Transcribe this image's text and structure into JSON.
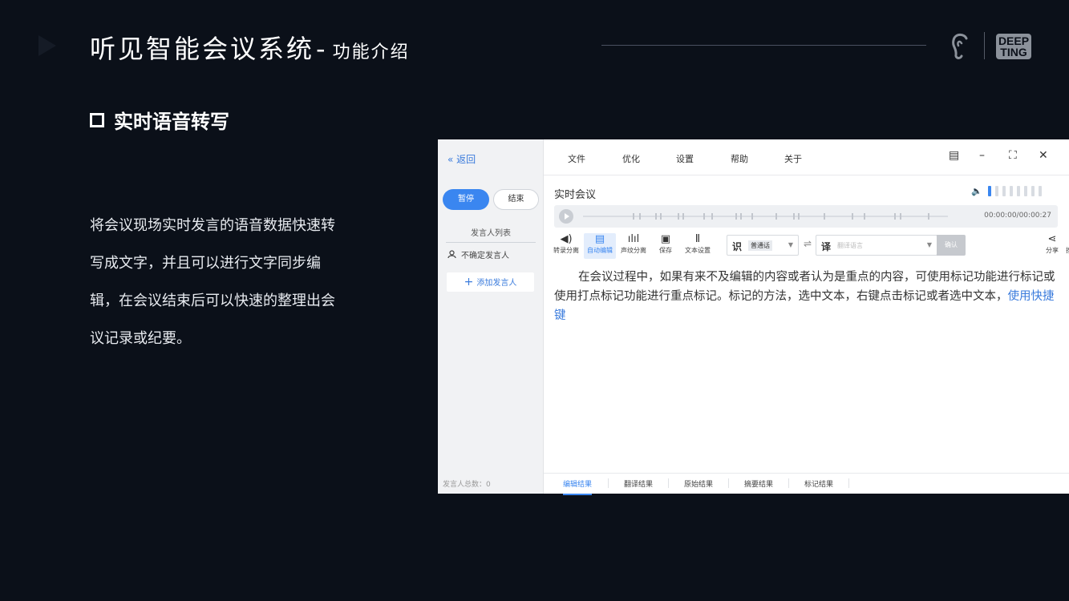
{
  "slide": {
    "title": "听见智能会议系统",
    "title_sep": "-",
    "subtitle": "功能介绍",
    "section_title": "实时语音转写",
    "description": "将会议现场实时发言的语音数据快速转写成文字，并且可以进行文字同步编辑，在会议结束后可以快速的整理出会议记录或纪要。",
    "brand_text": "DEEP TING"
  },
  "app": {
    "sidebar": {
      "back": "返回",
      "pause": "暂停",
      "end": "结束",
      "speaker_list_title": "发言人列表",
      "unknown_speaker": "不确定发言人",
      "add_speaker": "添加发言人",
      "speaker_count": "发言人总数：0"
    },
    "menu": [
      "文件",
      "优化",
      "设置",
      "帮助",
      "关于"
    ],
    "meeting_title": "实时会议",
    "volume_level": "1/8",
    "player_time": "00:00:00/00:00:27",
    "tools": {
      "speaker": "转录分离",
      "auto": "自动编辑",
      "voice": "声纹分离",
      "save": "保存",
      "text": "文本设置",
      "share": "分享",
      "search": "搜索"
    },
    "lang_key": "识",
    "lang_value": "普通话",
    "trans_key": "译",
    "trans_placeholder": "翻译语言",
    "confirm": "确认",
    "content_main": "在会议过程中，如果有来不及编辑的内容或者认为是重点的内容，可使用标记功能进行标记或使用打点标记功能进行重点标记。标记的方法，选中文本，右键点击标记或者选中文本，",
    "content_link": "使用快捷键",
    "tabs": [
      "编辑结果",
      "翻译结果",
      "原始结果",
      "摘要结果",
      "标记结果"
    ],
    "accent_color": "#3a86f0"
  }
}
